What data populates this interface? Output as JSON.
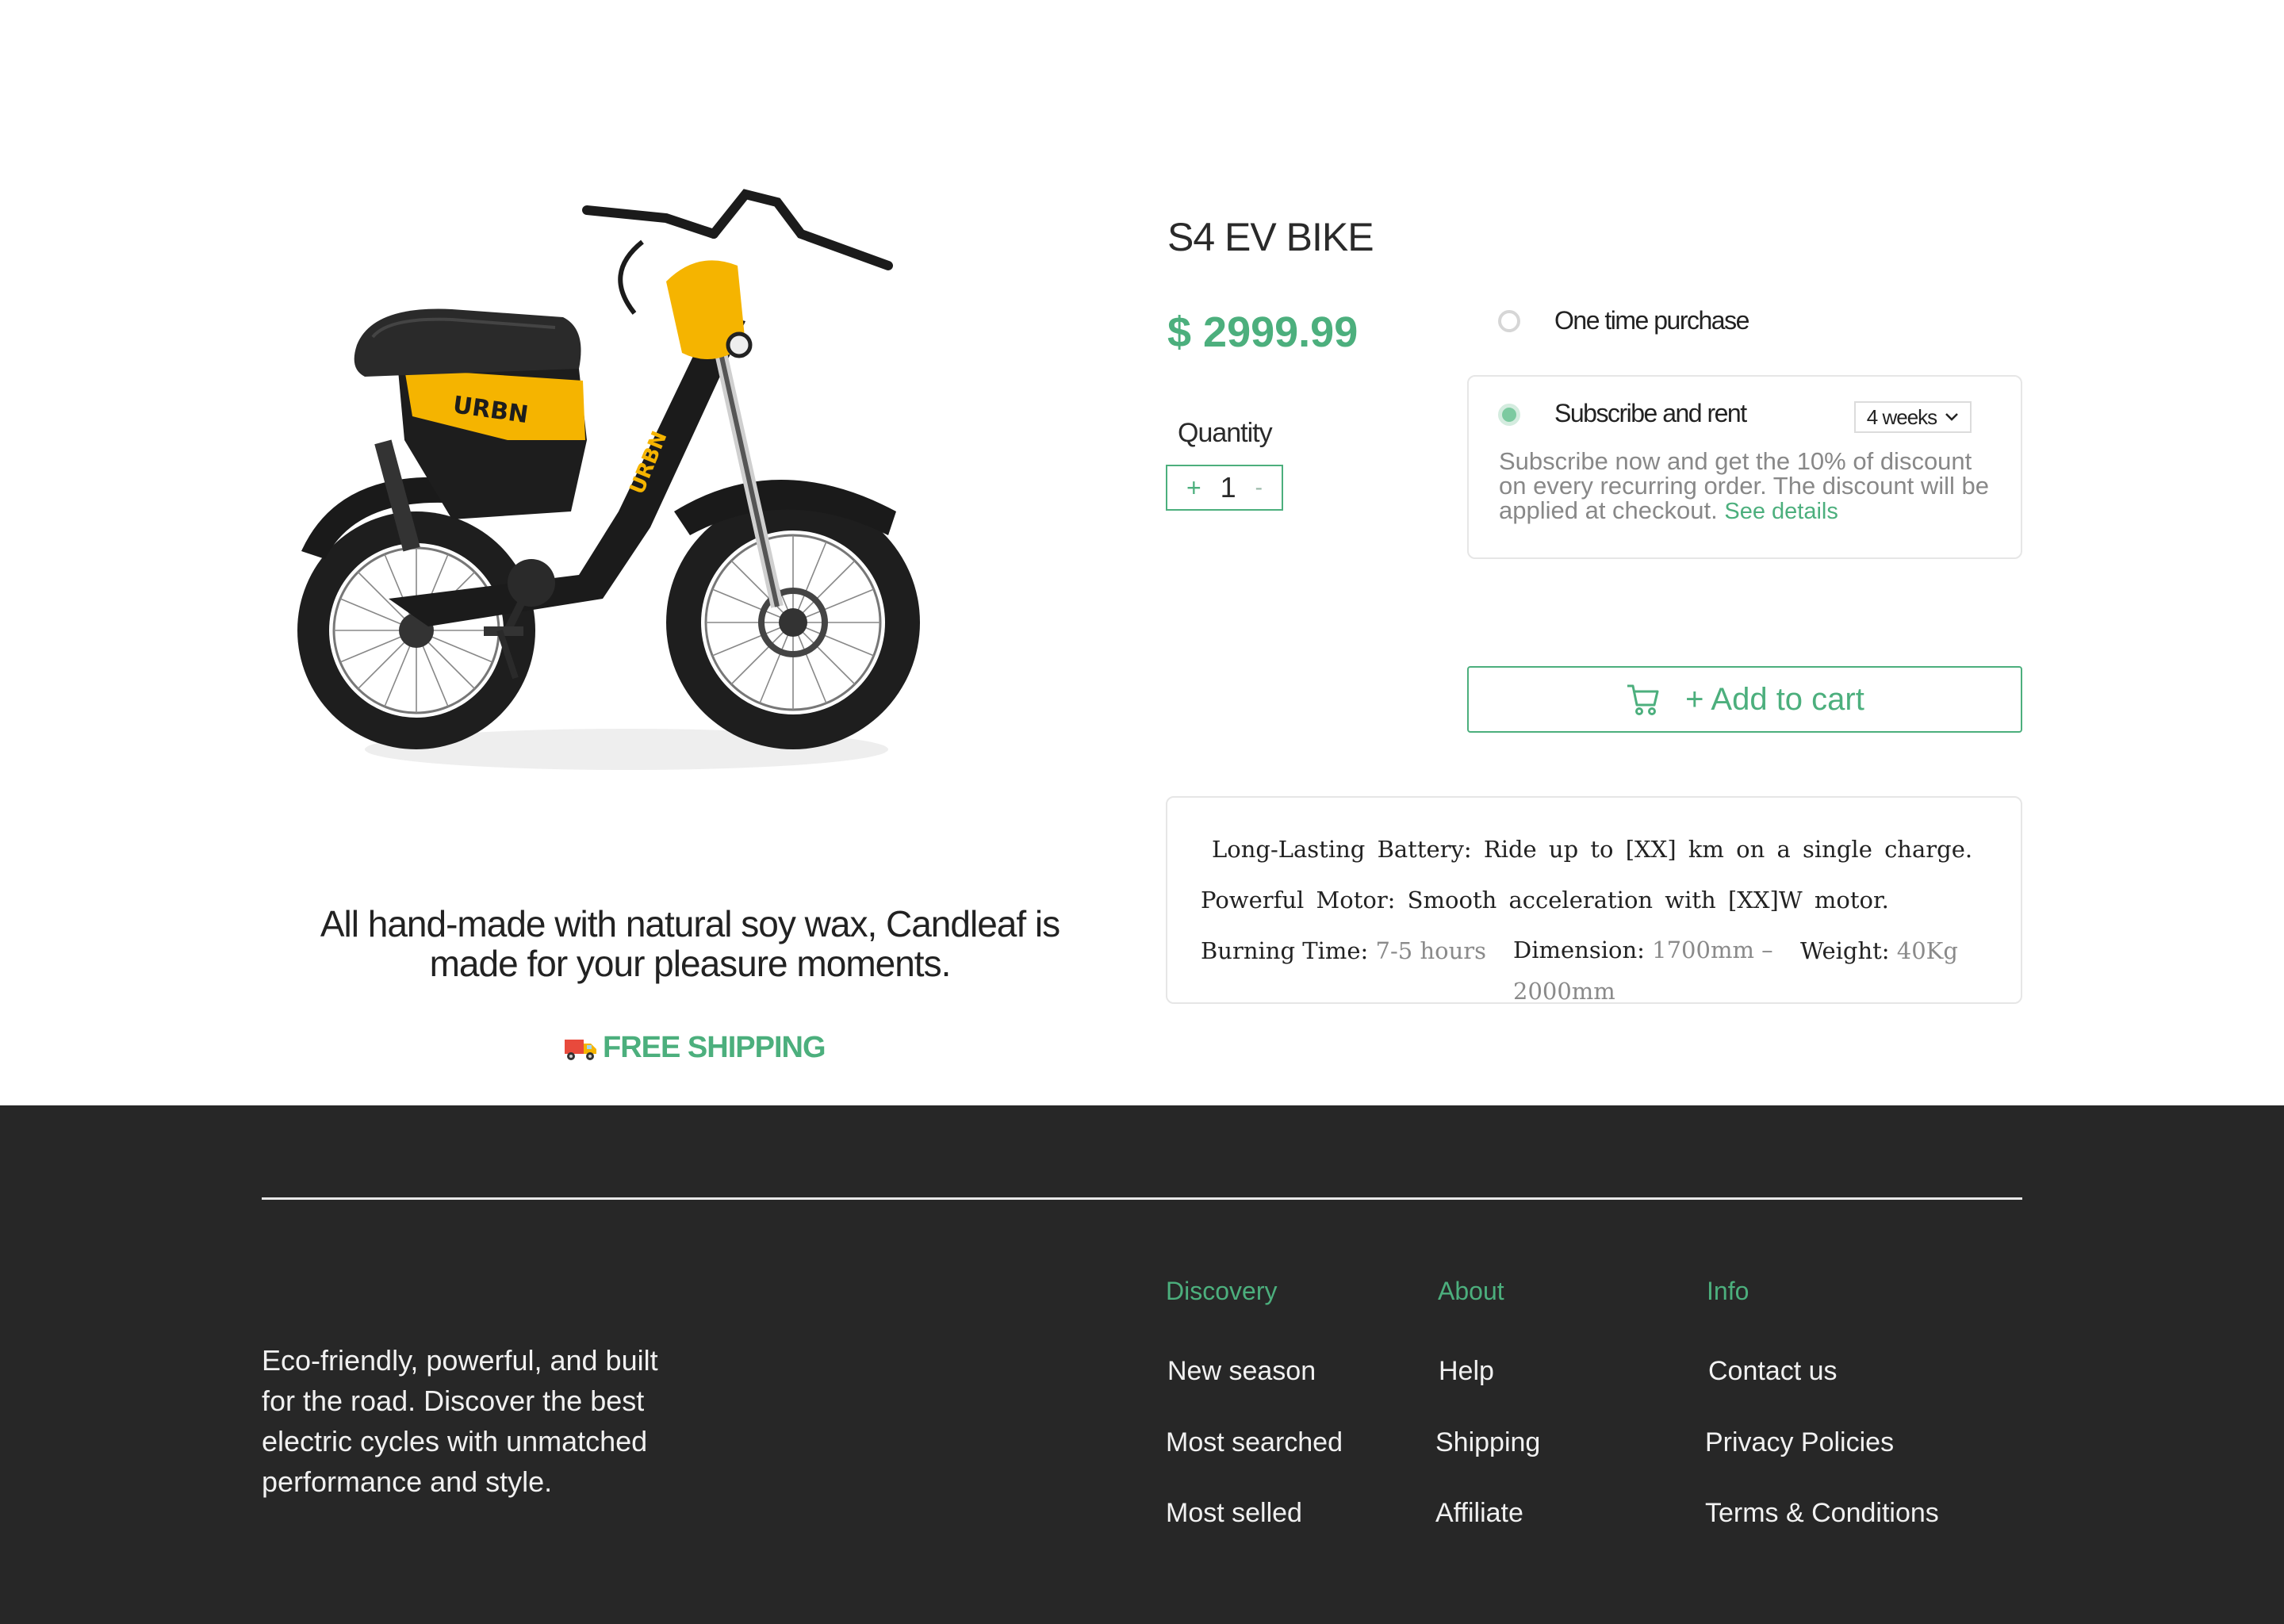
{
  "product": {
    "image_alt": "",
    "title": "S4 EV BIKE",
    "price": "$ 2999.99",
    "quantity_label": "Quantity",
    "quantity": {
      "plus": "+",
      "value": "1",
      "minus": "-"
    }
  },
  "purchase_options": {
    "one_time_label": "One time purchase",
    "subscribe_label": "Subscribe and rent",
    "selected": "subscribe",
    "interval": "4 weeks",
    "description": "Subscribe now and get the 10% of discount on every recurring order.  The discount will be applied at checkout.",
    "details_link": "See details"
  },
  "cart": {
    "label": "+ Add to cart"
  },
  "features": {
    "line1": "Long-Lasting Battery: Ride up to [XX] km on a single charge.",
    "line2": "Powerful Motor: Smooth acceleration with [XX]W motor.",
    "burning_label": "Burning Time:",
    "burning_value": "7-5 hours",
    "dimension_label": "Dimension:",
    "dimension_value": "1700mm – 2000mm",
    "weight_label": "Weight:",
    "weight_value": "40Kg"
  },
  "tagline": "All hand-made with natural soy wax, Candleaf is made for your pleasure moments.",
  "shipping": "FREE SHIPPING",
  "footer": {
    "description": "Eco-friendly, powerful, and built for the road. Discover the best electric cycles with unmatched performance and style.",
    "columns": [
      {
        "heading": "Discovery",
        "items": [
          "New season",
          "Most searched",
          "Most selled"
        ]
      },
      {
        "heading": "About",
        "items": [
          "Help",
          "Shipping",
          "Affiliate"
        ]
      },
      {
        "heading": "Info",
        "items": [
          "Contact us",
          "Privacy Policies",
          "Terms & Conditions"
        ]
      }
    ]
  },
  "colors": {
    "accent": "#4caf7d",
    "footer_bg": "#272727",
    "bike_yellow": "#f5b400"
  }
}
